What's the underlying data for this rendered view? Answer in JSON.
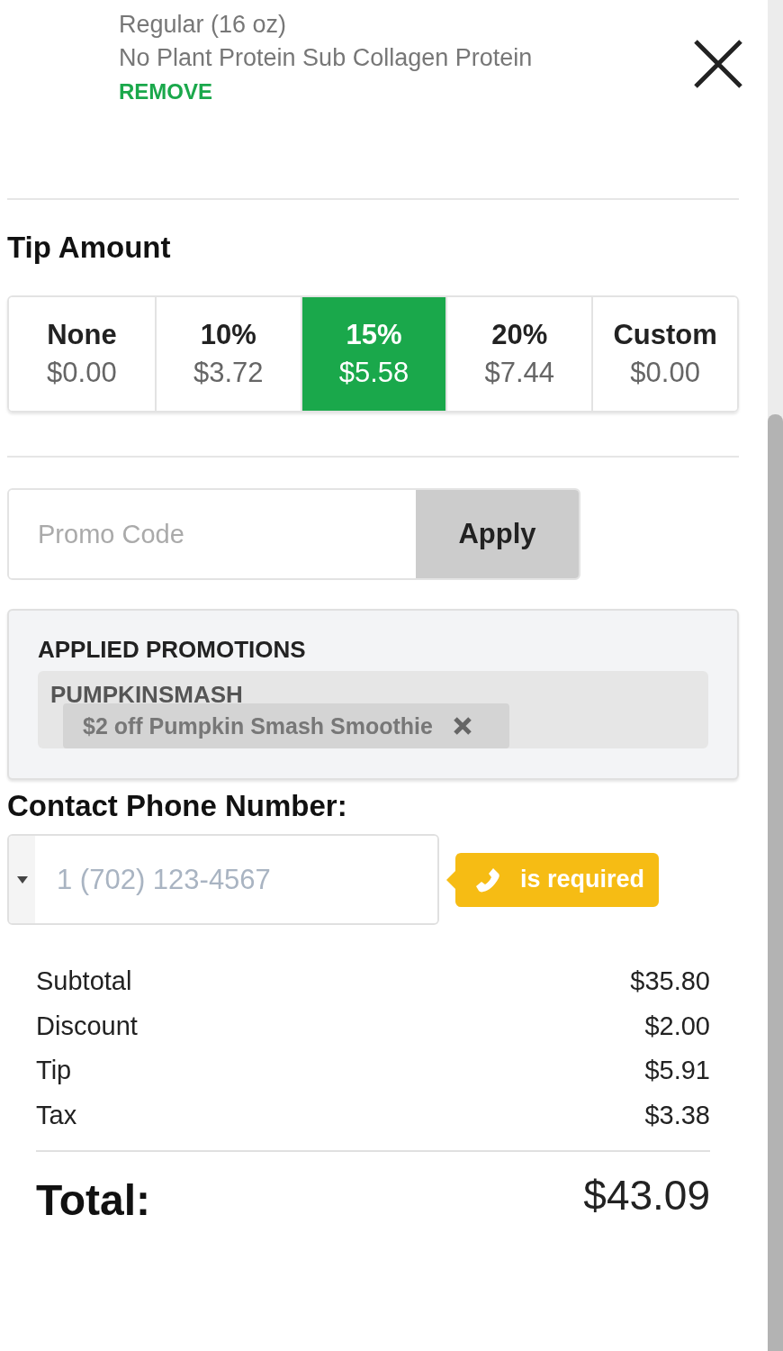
{
  "item": {
    "size": "Regular (16 oz)",
    "modifier": "No Plant Protein Sub Collagen Protein",
    "remove_label": "REMOVE"
  },
  "tip": {
    "title": "Tip Amount",
    "options": [
      {
        "label": "None",
        "amount": "$0.00",
        "selected": false
      },
      {
        "label": "10%",
        "amount": "$3.72",
        "selected": false
      },
      {
        "label": "15%",
        "amount": "$5.58",
        "selected": true
      },
      {
        "label": "20%",
        "amount": "$7.44",
        "selected": false
      },
      {
        "label": "Custom",
        "amount": "$0.00",
        "selected": false
      }
    ]
  },
  "promo": {
    "placeholder": "Promo Code",
    "button": "Apply"
  },
  "applied_promotions": {
    "title": "APPLIED PROMOTIONS",
    "items": [
      {
        "code": "PUMPKINSMASH",
        "description": "$2 off Pumpkin Smash Smoothie"
      }
    ]
  },
  "contact": {
    "title": "Contact Phone Number:",
    "placeholder": "1 (702) 123-4567",
    "error": "is required"
  },
  "summary": [
    {
      "label": "Subtotal",
      "value": "$35.80"
    },
    {
      "label": "Discount",
      "value": "$2.00"
    },
    {
      "label": "Tip",
      "value": "$5.91"
    },
    {
      "label": "Tax",
      "value": "$3.38"
    }
  ],
  "total": {
    "label": "Total:",
    "value": "$43.09"
  }
}
